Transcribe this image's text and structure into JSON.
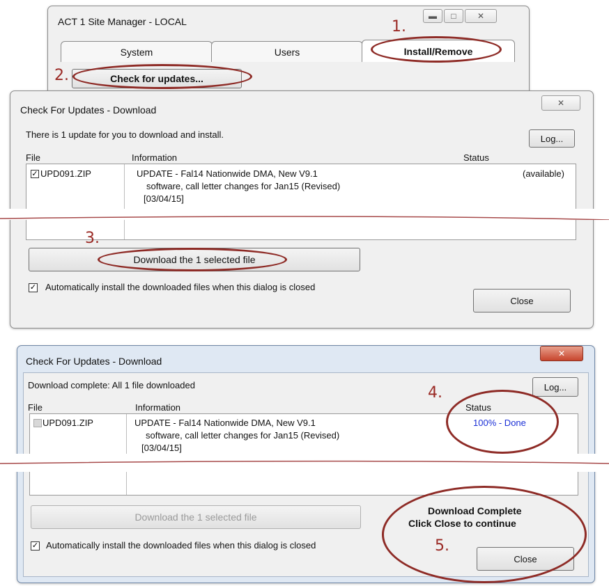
{
  "site_manager": {
    "title": "ACT 1 Site Manager - LOCAL",
    "tabs": [
      "System",
      "Users",
      "Install/Remove"
    ],
    "check_button": "Check for updates..."
  },
  "dialog1": {
    "title": "Check For Updates - Download",
    "message": "There is 1 update for you to download and install.",
    "log_button": "Log...",
    "columns": {
      "file": "File",
      "information": "Information",
      "status": "Status"
    },
    "row": {
      "file": "UPD091.ZIP",
      "info_lines": [
        "UPDATE - Fal14 Nationwide DMA, New V9.1",
        "software, call letter changes for Jan15 (Revised)",
        "[03/04/15]"
      ],
      "status": "(available)",
      "checked": true
    },
    "download_button": "Download the 1 selected file",
    "auto_install_label": "Automatically install the downloaded files when this dialog is closed",
    "close_button": "Close"
  },
  "dialog2": {
    "title": "Check For Updates - Download",
    "message": "Download complete: All 1 file downloaded",
    "log_button": "Log...",
    "columns": {
      "file": "File",
      "information": "Information",
      "status": "Status"
    },
    "row": {
      "file": "UPD091.ZIP",
      "info_lines": [
        "UPDATE - Fal14 Nationwide DMA, New V9.1",
        "software, call letter changes for Jan15 (Revised)",
        "[03/04/15]"
      ],
      "status": "100% - Done"
    },
    "download_button": "Download the 1 selected file",
    "auto_install_label": "Automatically install the downloaded files when this dialog is closed",
    "close_button": "Close",
    "complete_line1": "Download Complete",
    "complete_line2": "Click Close to continue"
  },
  "annotations": [
    "1.",
    "2.",
    "3.",
    "4.",
    "5."
  ],
  "colors": {
    "annotation": "#8e2b26",
    "status_done": "#1a2fd6"
  }
}
